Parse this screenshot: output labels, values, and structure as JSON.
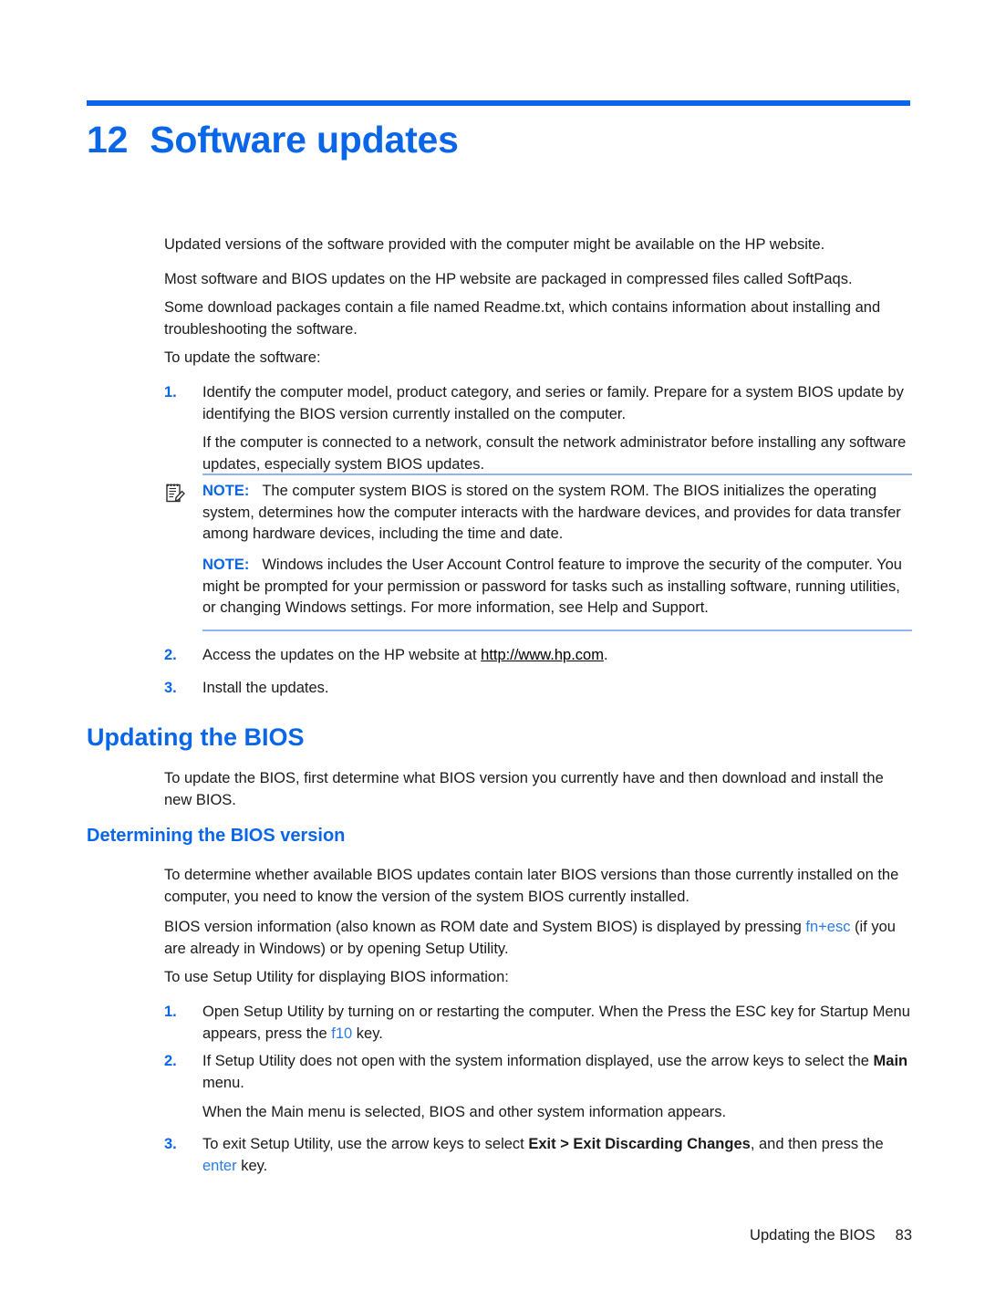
{
  "document": {
    "chapter_number": "12",
    "chapter_title": "Software updates",
    "accent_color": "#0a66e8",
    "note_rule_color": "#8fb4ee"
  },
  "intro": {
    "p1": "Updated versions of the software provided with the computer might be available on the HP website.",
    "p2": "Most software and BIOS updates on the HP website are packaged in compressed files called SoftPaqs.",
    "p3": "Some download packages contain a file named Readme.txt, which contains information about installing and troubleshooting the software.",
    "lead_in": "To update the software:"
  },
  "steps_update_software": [
    {
      "marker": "1.",
      "text": "Identify the computer model, product category, and series or family. Prepare for a system BIOS update by identifying the BIOS version currently installed on the computer."
    },
    {
      "marker": "2.",
      "text_before_link": "Access the updates on the HP website at ",
      "link_text": "http://www.hp.com",
      "text_after_link": "."
    },
    {
      "marker": "3.",
      "text": "Install the updates."
    }
  ],
  "step1_followup": "If the computer is connected to a network, consult the network administrator before installing any software updates, especially system BIOS updates.",
  "notes": [
    {
      "icon": "note-memo-icon",
      "label": "NOTE:",
      "text": "The computer system BIOS is stored on the system ROM. The BIOS initializes the operating system, determines how the computer interacts with the hardware devices, and provides for data transfer among hardware devices, including the time and date."
    },
    {
      "icon": null,
      "label": "NOTE:",
      "text": "Windows includes the User Account Control feature to improve the security of the computer. You might be prompted for your permission or password for tasks such as installing software, running utilities, or changing Windows settings. For more information, see Help and Support."
    }
  ],
  "section_updating_bios": {
    "heading": "Updating the BIOS",
    "intro": "To update the BIOS, first determine what BIOS version you currently have and then download and install the new BIOS."
  },
  "section_determining_version": {
    "heading": "Determining the BIOS version",
    "p1": "To determine whether available BIOS updates contain later BIOS versions than those currently installed on the computer, you need to know the version of the system BIOS currently installed.",
    "p2_part1": "BIOS version information (also known as ROM date and System BIOS) is displayed by pressing ",
    "p2_key1": "fn",
    "p2_part2": "",
    "p2_key2": "+esc",
    "p2_part3": " (if you are already in Windows) or by opening Setup Utility.",
    "lead_in": "To use Setup Utility for displaying BIOS information:"
  },
  "steps_setup_utility": [
    {
      "marker": "1.",
      "text_part1": "Open Setup Utility by turning on or restarting the computer. When the Press the ESC key for Startup Menu appears, press the ",
      "key": "f10",
      "text_part2": " key."
    },
    {
      "marker": "2.",
      "text_part1": "If Setup Utility does not open with the system information displayed, use the arrow keys to select the ",
      "bold": "Main",
      "text_part2": " menu."
    },
    {
      "marker": "3.",
      "text_part1": "To exit Setup Utility, use the arrow keys to select ",
      "bold": "Exit > Exit Discarding Changes",
      "text_part2": ", and then press the ",
      "key": "enter",
      "text_part3": " key."
    }
  ],
  "step2_followup": "When the Main menu is selected, BIOS and other system information appears.",
  "footer": {
    "section_label": "Updating the BIOS",
    "page_number": "83"
  }
}
